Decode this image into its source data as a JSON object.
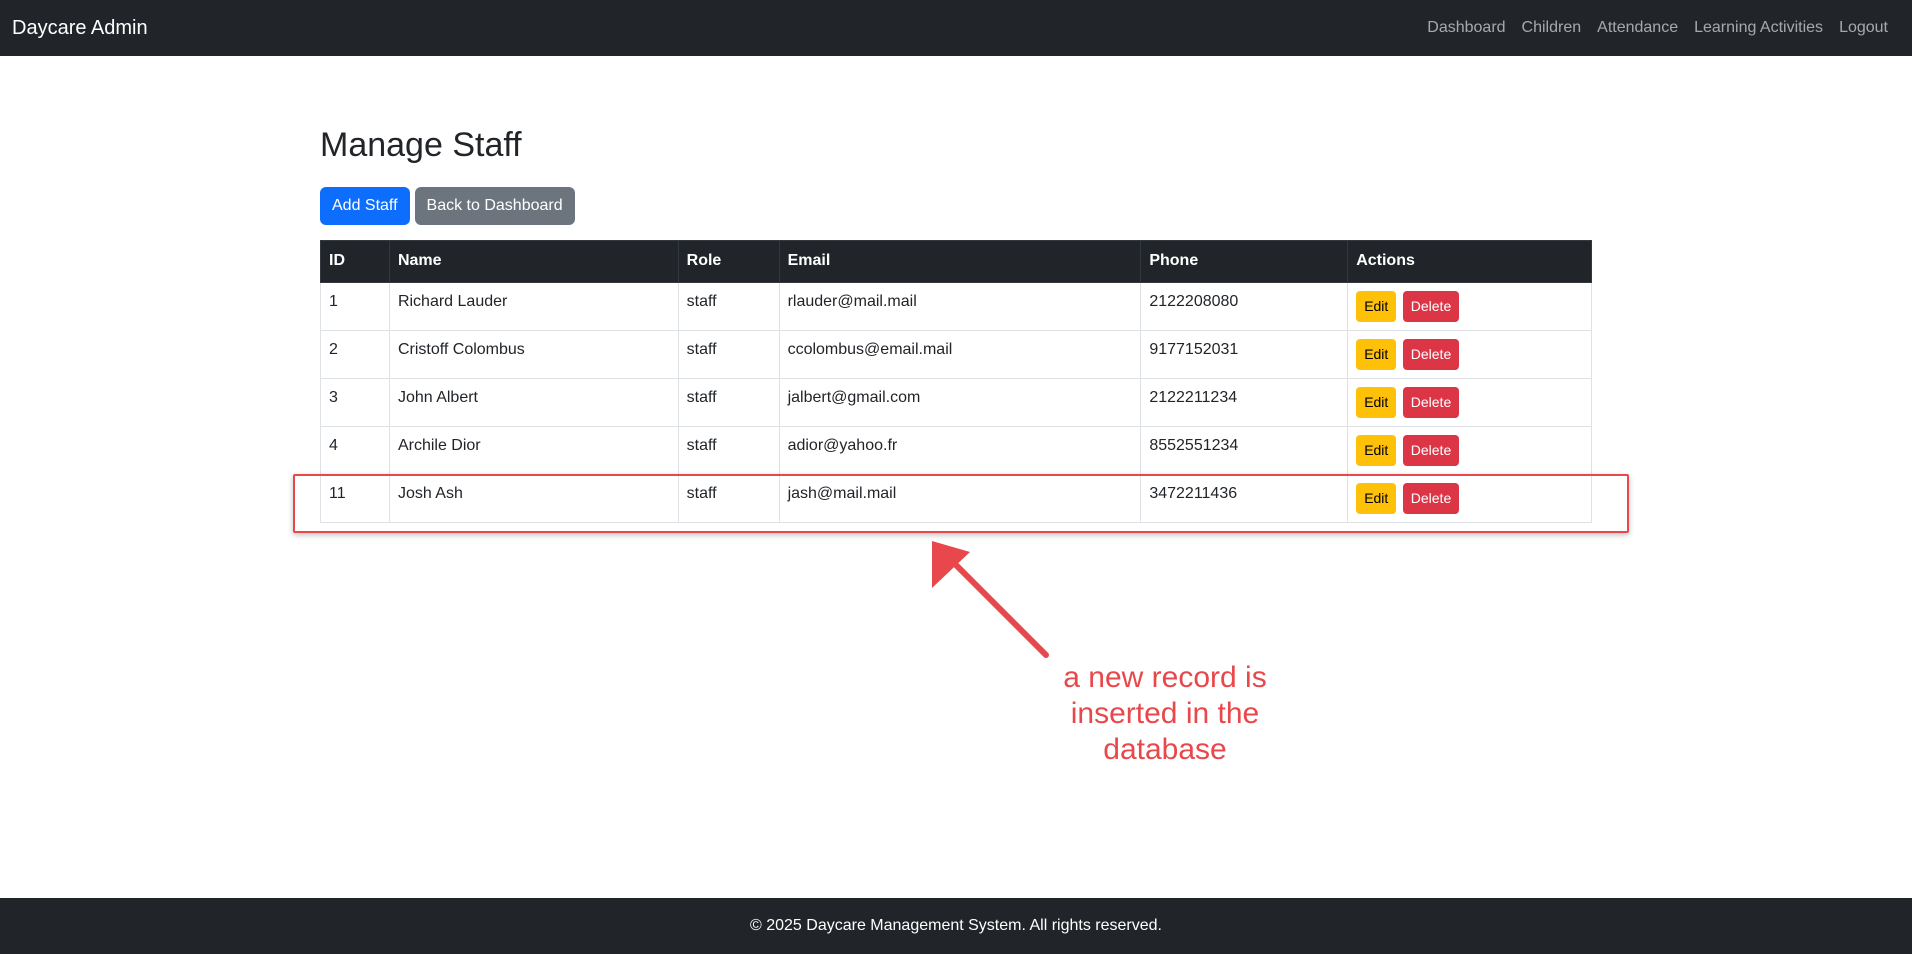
{
  "navbar": {
    "brand": "Daycare Admin",
    "links": [
      "Dashboard",
      "Children",
      "Attendance",
      "Learning Activities",
      "Logout"
    ]
  },
  "page": {
    "title": "Manage Staff",
    "add_button": "Add Staff",
    "back_button": "Back to Dashboard"
  },
  "table": {
    "headers": [
      "ID",
      "Name",
      "Role",
      "Email",
      "Phone",
      "Actions"
    ],
    "rows": [
      {
        "id": "1",
        "name": "Richard Lauder",
        "role": "staff",
        "email": "rlauder@mail.mail",
        "phone": "2122208080"
      },
      {
        "id": "2",
        "name": "Cristoff Colombus",
        "role": "staff",
        "email": "ccolombus@email.mail",
        "phone": "9177152031"
      },
      {
        "id": "3",
        "name": "John Albert",
        "role": "staff",
        "email": "jalbert@gmail.com",
        "phone": "2122211234"
      },
      {
        "id": "4",
        "name": "Archile Dior",
        "role": "staff",
        "email": "adior@yahoo.fr",
        "phone": "8552551234"
      },
      {
        "id": "11",
        "name": "Josh Ash",
        "role": "staff",
        "email": "jash@mail.mail",
        "phone": "3472211436"
      }
    ],
    "edit_label": "Edit",
    "delete_label": "Delete"
  },
  "annotation": {
    "lines": [
      "a new record is",
      "inserted in the",
      "database"
    ],
    "color": "#e8474c"
  },
  "footer": {
    "text": "© 2025 Daycare Management System. All rights reserved."
  },
  "colors": {
    "navbar_bg": "#212529",
    "primary": "#0d6efd",
    "secondary": "#6c757d",
    "warning": "#ffc107",
    "danger": "#dc3545"
  }
}
